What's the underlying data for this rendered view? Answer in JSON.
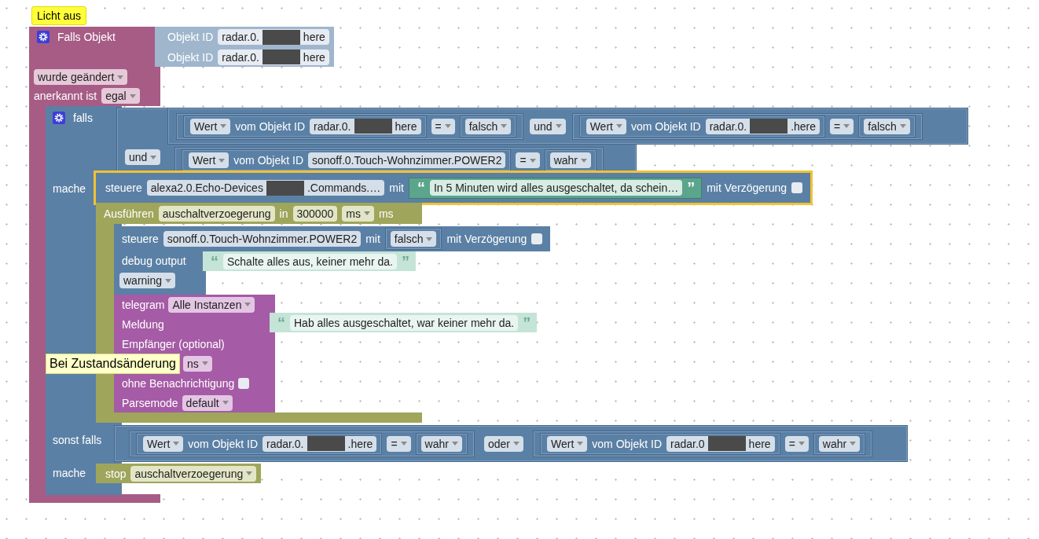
{
  "comment": {
    "text": "Licht aus"
  },
  "trigger": {
    "title": "Falls Objekt",
    "objects": [
      {
        "label": "Objekt ID",
        "id": {
          "prefix": "radar.0.",
          "redacted": true,
          "suffix": "here"
        }
      },
      {
        "label": "Objekt ID",
        "id": {
          "prefix": "radar.0.",
          "redacted": true,
          "suffix": "here"
        }
      }
    ],
    "event": "wurde geändert",
    "ack_label": "anerkannt ist",
    "ack": "egal"
  },
  "if_block": {
    "label": "falls",
    "do_label": "mache",
    "else_if_label": "sonst falls",
    "else_do_label": "mache",
    "condition": {
      "operator": "und",
      "first": {
        "operator": "und",
        "left": {
          "mode": "Wert",
          "label": "vom Objekt ID",
          "id": {
            "prefix": "radar.0.",
            "redacted": true,
            "suffix": "here"
          },
          "op": "=",
          "value": "falsch"
        },
        "right": {
          "mode": "Wert",
          "label": "vom Objekt ID",
          "id": {
            "prefix": "radar.0.",
            "redacted": true,
            "suffix": ".here"
          },
          "op": "=",
          "value": "falsch"
        }
      },
      "second": {
        "mode": "Wert",
        "label": "vom Objekt ID",
        "id": {
          "prefix": "sonoff.0.Touch-Wohnzimmer.POWER2",
          "redacted": false
        },
        "op": "=",
        "value": "wahr"
      }
    },
    "statements": [
      {
        "kind": "control",
        "selected": true,
        "label": "steuere",
        "id": {
          "prefix": "alexa2.0.Echo-Devices",
          "redacted": true,
          "suffix": ".Commands.…"
        },
        "with": "mit",
        "value": {
          "kind": "string",
          "quote_open": "“",
          "text": "In 5 Minuten wird alles ausgeschaltet, da schein…",
          "quote_close": "”"
        },
        "delay_label": "mit Verzögerung",
        "delay": false
      },
      {
        "kind": "timeout",
        "label": "Ausführen",
        "name": "auschaltverzoegerung",
        "in": "in",
        "duration": "300000",
        "unit": "ms",
        "unit_suffix": "ms",
        "body": [
          {
            "kind": "control",
            "selected": false,
            "label": "steuere",
            "id": {
              "prefix": "sonoff.0.Touch-Wohnzimmer.POWER2",
              "redacted": false
            },
            "with": "mit",
            "value": {
              "kind": "bool",
              "text": "falsch"
            },
            "delay_label": "mit Verzögerung",
            "delay": false
          },
          {
            "kind": "debug",
            "label": "debug output",
            "message": {
              "quote_open": "“",
              "text": "Schalte alles aus, keiner mehr da.",
              "quote_close": "”"
            },
            "severity": "warning"
          },
          {
            "kind": "telegram",
            "label": "telegram",
            "instance": "Alle Instanzen",
            "message_label": "Meldung",
            "message": {
              "quote_open": "“",
              "text": "Hab alles ausgeschaltet, war keiner mehr da.",
              "quote_close": "”"
            },
            "recipient_label": "Empfänger (optional)",
            "option": "ns",
            "silent_label": "ohne Benachrichtigung",
            "silent": false,
            "parse_label": "Parsemode",
            "parse": "default"
          }
        ]
      }
    ],
    "else_condition": {
      "operator": "oder",
      "left": {
        "mode": "Wert",
        "label": "vom Objekt ID",
        "id": {
          "prefix": "radar.0.",
          "redacted": true,
          "suffix": ".here"
        },
        "op": "=",
        "value": "wahr"
      },
      "right": {
        "mode": "Wert",
        "label": "vom Objekt ID",
        "id": {
          "prefix": "radar.0",
          "redacted": true,
          "suffix": "here"
        },
        "op": "=",
        "value": "wahr"
      }
    },
    "else_statements": [
      {
        "kind": "stop",
        "label": "stop",
        "name": "auschaltverzoegerung"
      }
    ]
  },
  "tooltip": {
    "text": "Bei Zustandsänderung"
  }
}
